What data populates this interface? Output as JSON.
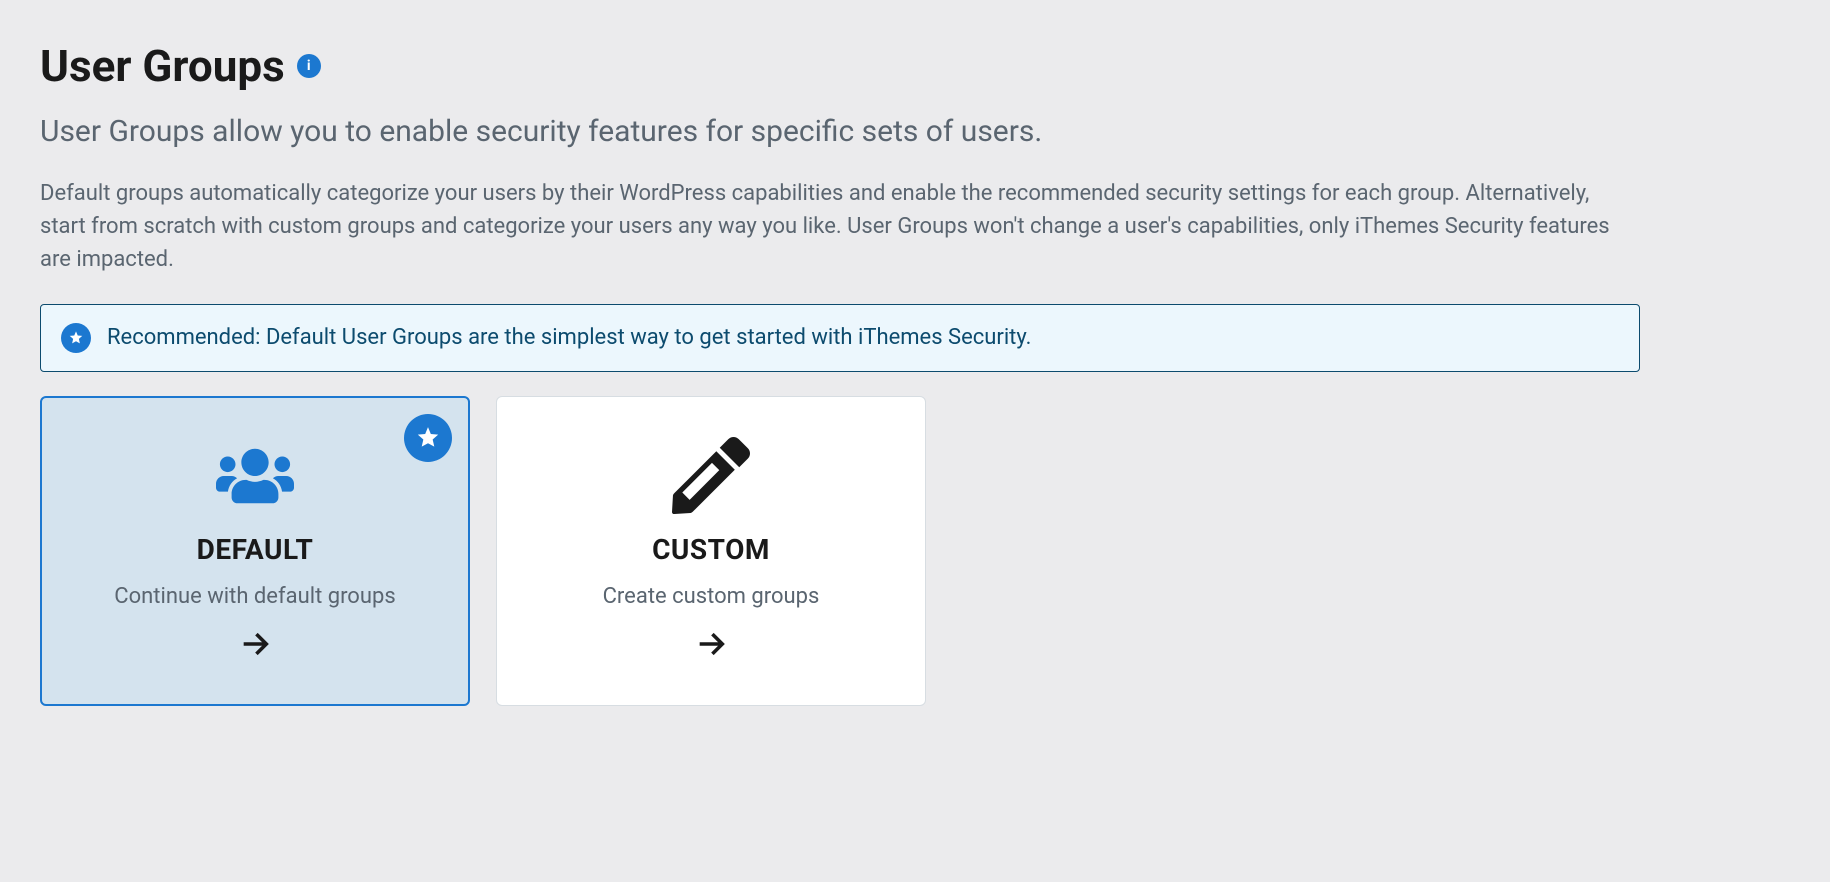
{
  "header": {
    "title": "User Groups",
    "subtitle": "User Groups allow you to enable security features for specific sets of users.",
    "description": "Default groups automatically categorize your users by their WordPress capabilities and enable the recommended security settings for each group. Alternatively, start from scratch with custom groups and categorize your users any way you like. User Groups won't change a user's capabilities, only iThemes Security features are impacted."
  },
  "notice": {
    "text": "Recommended: Default User Groups are the simplest way to get started with iThemes Security."
  },
  "cards": {
    "default": {
      "title": "DEFAULT",
      "description": "Continue with default groups"
    },
    "custom": {
      "title": "CUSTOM",
      "description": "Create custom groups"
    }
  }
}
